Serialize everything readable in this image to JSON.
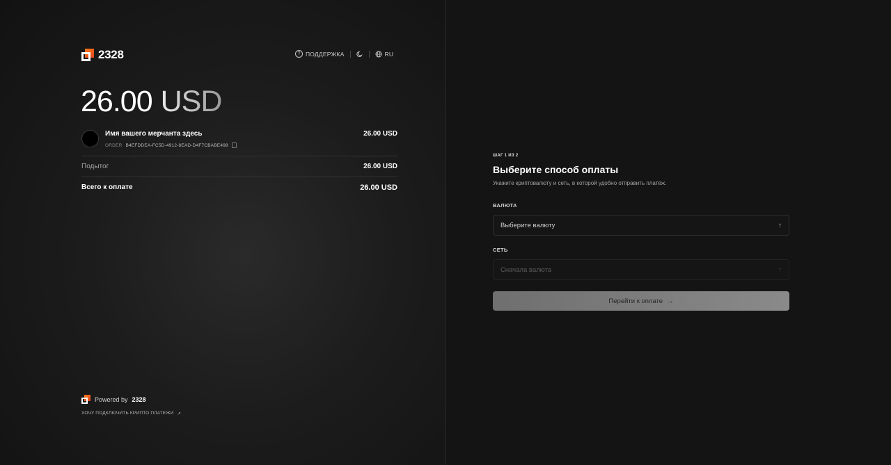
{
  "brand": {
    "name": "2328",
    "accent_color": "#ff7a1a"
  },
  "header": {
    "support_label": "ПОДДЕРЖКА",
    "support_icon": "help-circle-icon",
    "theme_icon": "moon-icon",
    "language_label": "RU",
    "language_icon": "globe-icon"
  },
  "summary": {
    "amount": "26.00",
    "currency": "USD",
    "merchant_name": "Имя вашего мерчанта здесь",
    "merchant_price": "26.00 USD",
    "order_label": "ORDER",
    "order_id": "B4EFDDEA-FC5D-4912-8EAD-D4F7CBABE498",
    "subtotal_label": "Подытог",
    "subtotal_value": "26.00 USD",
    "total_label": "Всего к оплате",
    "total_value": "26.00 USD"
  },
  "footer": {
    "powered_prefix": "Powered by",
    "powered_brand": "2328",
    "connect_link": "ХОЧУ ПОДКЛЮЧИТЬ КРИПТО ПЛАТЕЖИ",
    "connect_icon": "arrow-up-right-icon"
  },
  "form": {
    "step": "ШАГ 1 ИЗ 2",
    "title": "Выберите способ оплаты",
    "subtitle": "Укажите криптовалюту и сеть, в которой удобно отправить платёж.",
    "currency_label": "ВАЛЮТА",
    "currency_placeholder": "Выберите валюту",
    "network_label": "СЕТЬ",
    "network_placeholder": "Сначала валюта",
    "submit_label": "Перейти к оплате"
  }
}
